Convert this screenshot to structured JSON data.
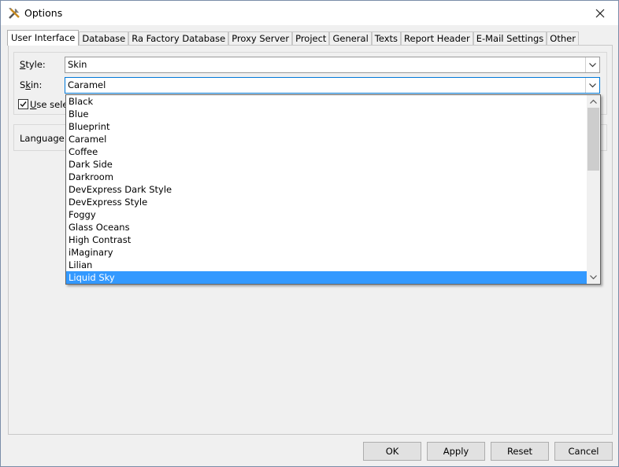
{
  "window": {
    "title": "Options"
  },
  "tabs": [
    {
      "label": "User Interface"
    },
    {
      "label": "Database"
    },
    {
      "label": "Ra Factory Database"
    },
    {
      "label": "Proxy Server"
    },
    {
      "label": "Project"
    },
    {
      "label": "General"
    },
    {
      "label": "Texts"
    },
    {
      "label": "Report Header"
    },
    {
      "label": "E-Mail Settings"
    },
    {
      "label": "Other"
    }
  ],
  "style": {
    "label_first": "S",
    "label_rest": "tyle:",
    "value": "Skin"
  },
  "skin": {
    "label_first": "S",
    "label_mid": "k",
    "label_rest": "in:",
    "value": "Caramel"
  },
  "checkbox": {
    "label_first": "U",
    "label_rest": "se selec"
  },
  "language": {
    "label": "Language:"
  },
  "skin_options": [
    "Black",
    "Blue",
    "Blueprint",
    "Caramel",
    "Coffee",
    "Dark Side",
    "Darkroom",
    "DevExpress Dark Style",
    "DevExpress Style",
    "Foggy",
    "Glass Oceans",
    "High Contrast",
    "iMaginary",
    "Lilian",
    "Liquid Sky"
  ],
  "selected_option": "Liquid Sky",
  "buttons": {
    "ok": "OK",
    "apply": "Apply",
    "reset": "Reset",
    "cancel": "Cancel"
  },
  "colors": {
    "selection": "#3399ff"
  }
}
